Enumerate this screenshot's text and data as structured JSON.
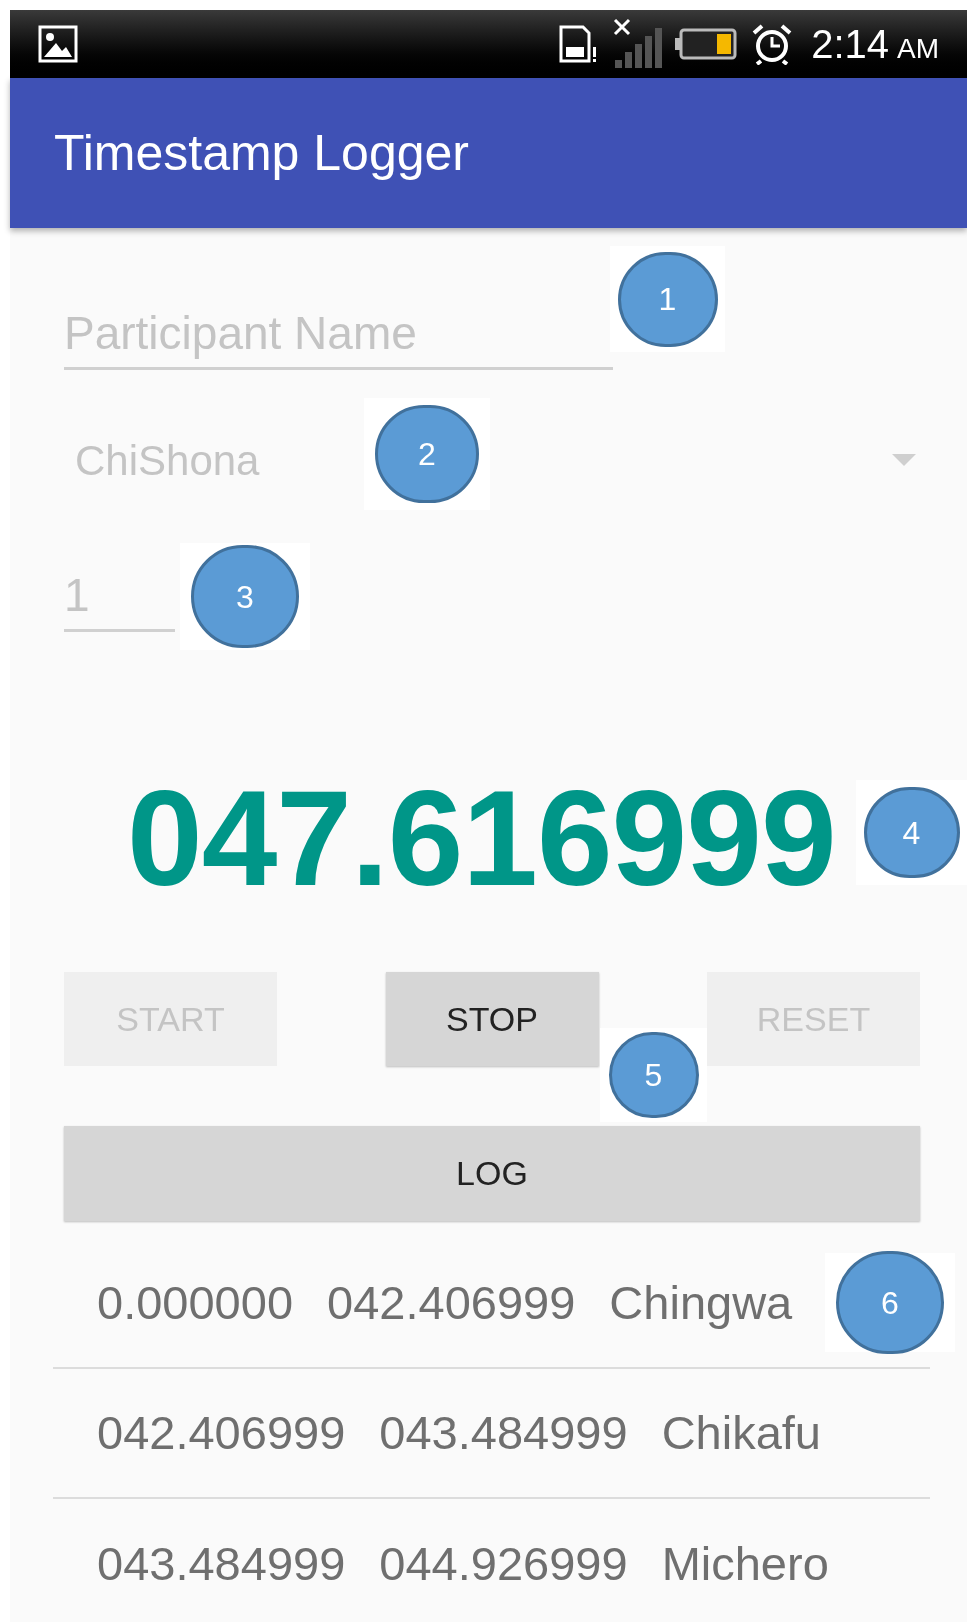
{
  "status_bar": {
    "time": "2:14",
    "meridiem": "AM"
  },
  "app_bar": {
    "title": "Timestamp Logger"
  },
  "participant_field": {
    "placeholder": "Participant Name"
  },
  "language_spinner": {
    "value": "ChiShona",
    "disabled": true
  },
  "number_field": {
    "placeholder": "1"
  },
  "timer": {
    "reading": "047.616999"
  },
  "buttons": [
    {
      "label": "START",
      "disabled": true
    },
    {
      "label": "STOP",
      "disabled": false
    },
    {
      "label": "RESET",
      "disabled": true
    }
  ],
  "log_button": {
    "label": "LOG"
  },
  "log_entries": [
    {
      "start": "0.000000",
      "end": "042.406999",
      "word": "Chingwa"
    },
    {
      "start": "042.406999",
      "end": "043.484999",
      "word": "Chikafu"
    },
    {
      "start": "043.484999",
      "end": "044.926999",
      "word": "Michero"
    }
  ],
  "annotations": [
    {
      "label": "1"
    },
    {
      "label": "2"
    },
    {
      "label": "3"
    },
    {
      "label": "4"
    },
    {
      "label": "5"
    },
    {
      "label": "6"
    }
  ]
}
